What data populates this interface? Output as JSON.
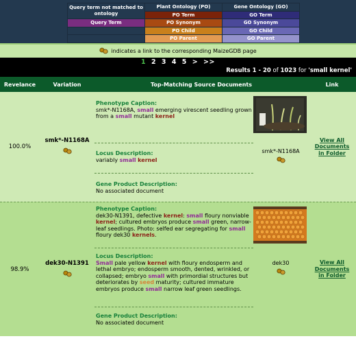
{
  "legend": {
    "col1_header": "Query term not matched to ontology",
    "col1_term": "Query Term",
    "po_header": "Plant Ontology (PO)",
    "po_items": [
      "PO Term",
      "PO Synonym",
      "PO Child",
      "PO Parent"
    ],
    "go_header": "Gene Ontology (GO)",
    "go_items": [
      "GO Term",
      "GO Synonym",
      "GO Child",
      "GO Parent"
    ]
  },
  "maize_note": "indicates a link to the corresponding MaizeGDB page",
  "pager": {
    "current": "1",
    "pages": [
      "2",
      "3",
      "4",
      "5"
    ],
    "next": ">",
    "last": ">>",
    "results_prefix": "Results ",
    "results_from": "1",
    "results_dash": " - ",
    "results_to": "20",
    "results_of": " of ",
    "results_total": "1023",
    "results_for": " for ",
    "results_query": "'small kernel'"
  },
  "columns": [
    "Revelance",
    "Variation",
    "Top-Matching Source Documents",
    "Link"
  ],
  "results": [
    {
      "relevance": "100.0%",
      "variation": "smk*-N1168A",
      "phenotype_title": "Phenotype Caption:",
      "locus_title": "Locus Description:",
      "product_title": "Gene Product Description:",
      "product_text": "No associated document",
      "locus_name": "smk*-N1168A",
      "link": "View All Documents in Folder",
      "image": "seedling-photo"
    },
    {
      "relevance": "98.9%",
      "variation": "dek30-N1391",
      "phenotype_title": "Phenotype Caption:",
      "locus_title": "Locus Description:",
      "product_title": "Gene Product Description:",
      "product_text": "No associated document",
      "locus_name": "dek30",
      "link": "View All Documents in Folder",
      "image": "corn-ear-photo"
    }
  ],
  "colors": {
    "header_bg": "#23394f",
    "query_term": "#7a2d80",
    "po_term": "#7b2309",
    "go_term": "#2f2c78",
    "column_header": "#0c5a2a",
    "row_bg_1": "#cfeab5",
    "row_bg_2": "#b4de91",
    "kernel_highlight": "#8b1f16",
    "small_highlight": "#8f2a95"
  },
  "icons": [
    "peanut-icon"
  ]
}
